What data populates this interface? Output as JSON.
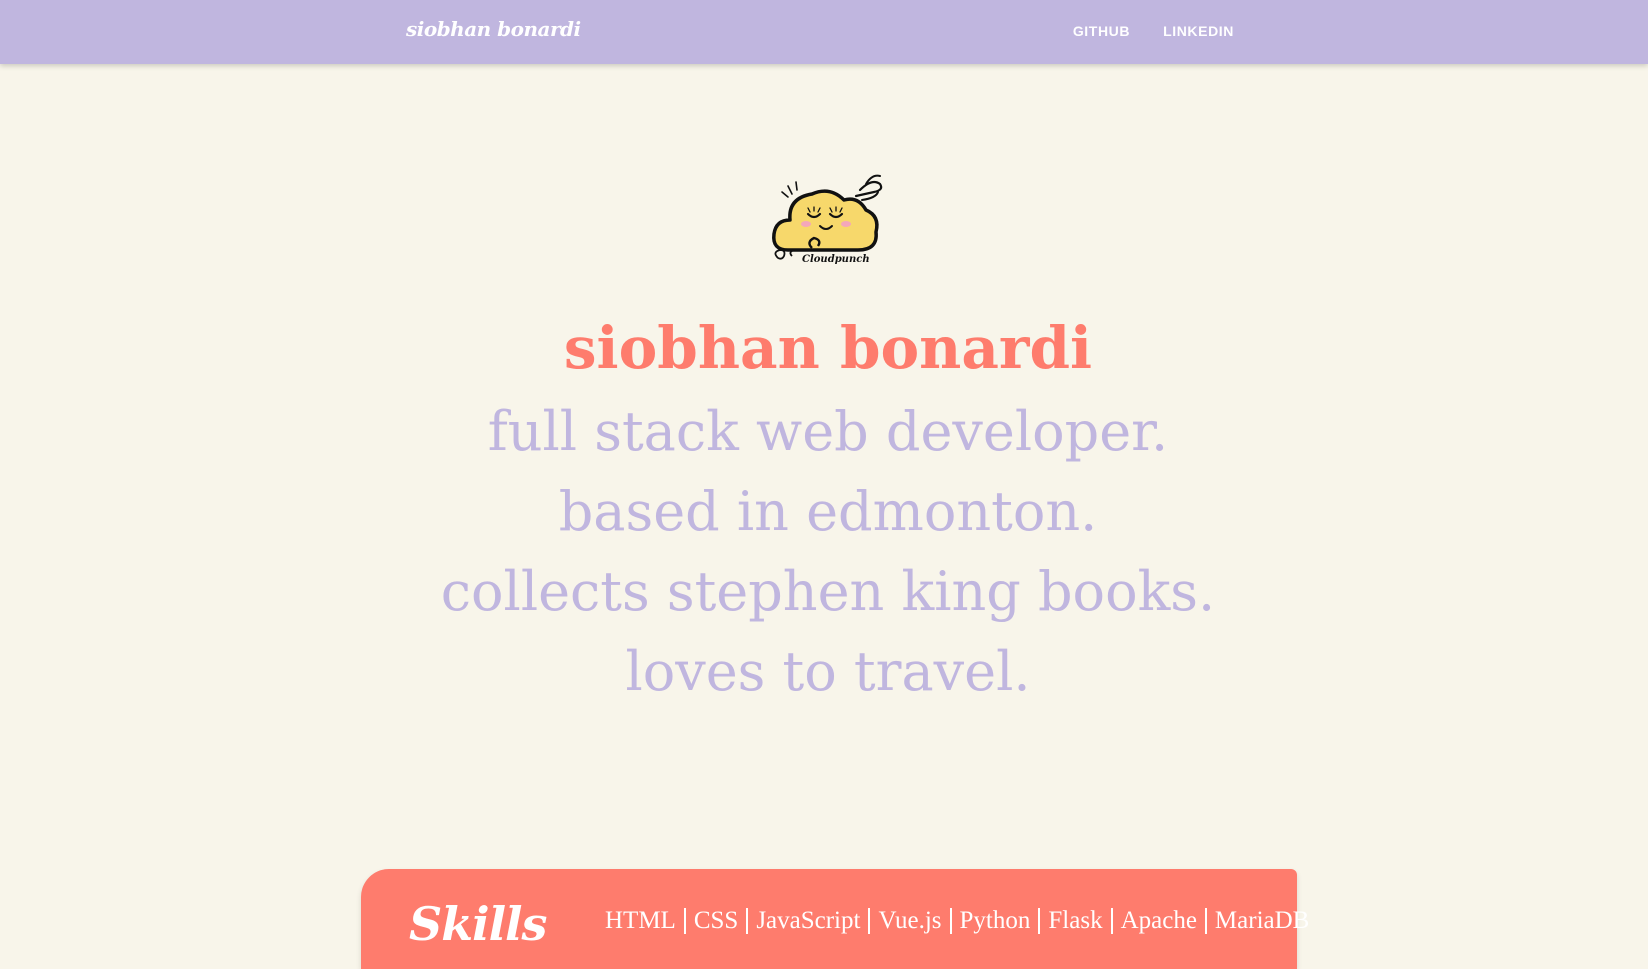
{
  "navbar": {
    "brand": "siobhan bonardi",
    "links": [
      "GITHUB",
      "LINKEDIN"
    ]
  },
  "logo": {
    "icon": "cloud-face-logo",
    "wordmark": "Cloudpunch",
    "colors": {
      "fill": "#f7d86b",
      "outline": "#111111",
      "blush": "#f4a7b9"
    }
  },
  "hero": {
    "name": "siobhan bonardi",
    "taglines": [
      "full stack web developer.",
      "based in edmonton.",
      "collects stephen king books.",
      "loves to travel."
    ]
  },
  "skills": {
    "title": "Skills",
    "items": [
      "HTML",
      "CSS",
      "JavaScript",
      "Vue.js",
      "Python",
      "Flask",
      "Apache",
      "MariaDB"
    ]
  },
  "colors": {
    "background": "#f8f5ea",
    "navbar": "#c0b6df",
    "accent": "#fe7c6d",
    "tagline": "#c0b6df"
  }
}
